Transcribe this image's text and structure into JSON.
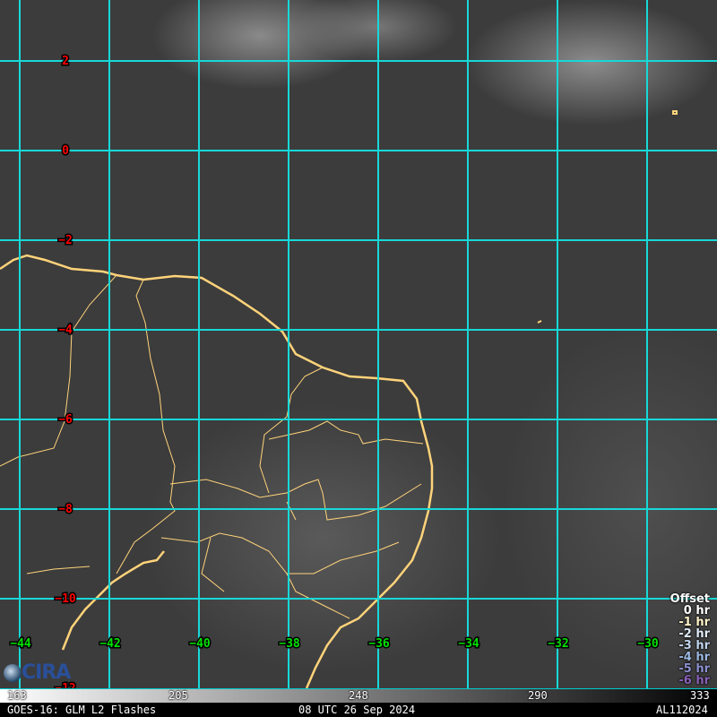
{
  "title": "GOES-16: GLM L2 Flashes",
  "timestamp": "08 UTC 26 Sep 2024",
  "storm_id": "AL112024",
  "logo_text": "CIRA",
  "latitude_labels": [
    "2",
    "0",
    "−2",
    "−4",
    "−6",
    "−8",
    "−10",
    "−12"
  ],
  "longitude_labels": [
    "−44",
    "−42",
    "−40",
    "−38",
    "−36",
    "−34",
    "−32",
    "−30"
  ],
  "colorbar": {
    "ticks": [
      "163",
      "205",
      "248",
      "290",
      "333"
    ]
  },
  "legend": {
    "title": "Offset",
    "items": [
      {
        "label": "0 hr",
        "color": "#ffffff"
      },
      {
        "label": "-1 hr",
        "color": "#fff3c8"
      },
      {
        "label": "-2 hr",
        "color": "#e0ecf8"
      },
      {
        "label": "-3 hr",
        "color": "#c0d4ec"
      },
      {
        "label": "-4 hr",
        "color": "#9cb8e0"
      },
      {
        "label": "-5 hr",
        "color": "#8c90d0"
      },
      {
        "label": "-6 hr",
        "color": "#8a60b8"
      }
    ]
  },
  "colors": {
    "grid": "#18d8d8",
    "coastline": "#ffd37a",
    "lat_label": "#ff0000",
    "lon_label": "#00e000"
  }
}
